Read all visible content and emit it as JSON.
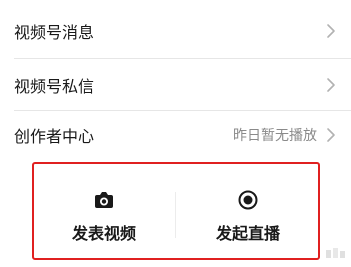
{
  "menu": {
    "items": [
      {
        "label": "视频号消息",
        "value": "",
        "chevron_icon": "chevron-right-icon"
      },
      {
        "label": "视频号私信",
        "value": "",
        "chevron_icon": "chevron-right-icon"
      },
      {
        "label": "创作者中心",
        "value": "昨日暂无播放",
        "chevron_icon": "chevron-right-icon"
      }
    ]
  },
  "actions": {
    "highlight_color": "#e02020",
    "publish": {
      "label": "发表视频",
      "icon": "camera-icon"
    },
    "live": {
      "label": "发起直播",
      "icon": "record-icon"
    }
  },
  "colors": {
    "text": "#191919",
    "secondary_text": "#8a8a8a",
    "divider": "#e6e6e6"
  }
}
